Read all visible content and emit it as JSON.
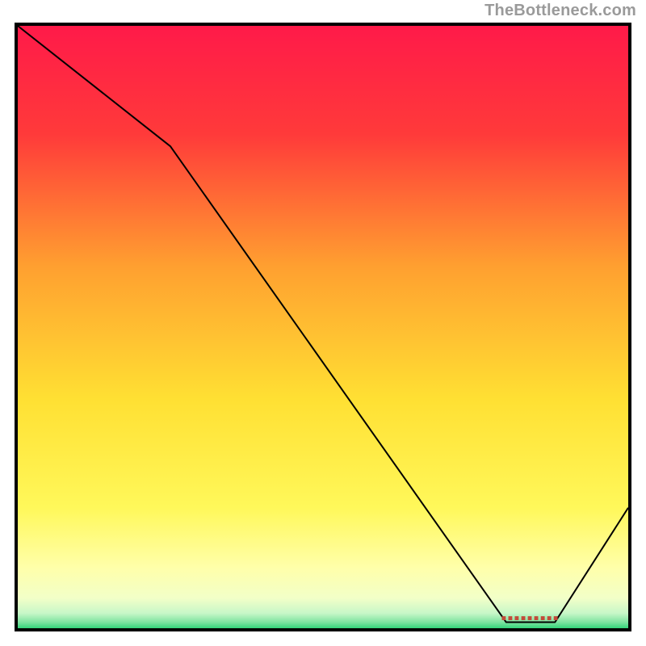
{
  "attribution": "TheBottleneck.com",
  "chart_data": {
    "type": "line",
    "title": "",
    "xlabel": "",
    "ylabel": "",
    "xlim": [
      0,
      100
    ],
    "ylim": [
      0,
      100
    ],
    "x": [
      0,
      25,
      80,
      88,
      100
    ],
    "values": [
      100,
      80,
      1,
      1,
      20
    ],
    "marker": {
      "x_start": 80,
      "x_end": 88,
      "y": 1,
      "label": "■■■■■■■■■"
    },
    "gradient_top_color": "#ff1a49",
    "gradient_bottom_color": "#33d47a",
    "line_color": "#000000"
  }
}
